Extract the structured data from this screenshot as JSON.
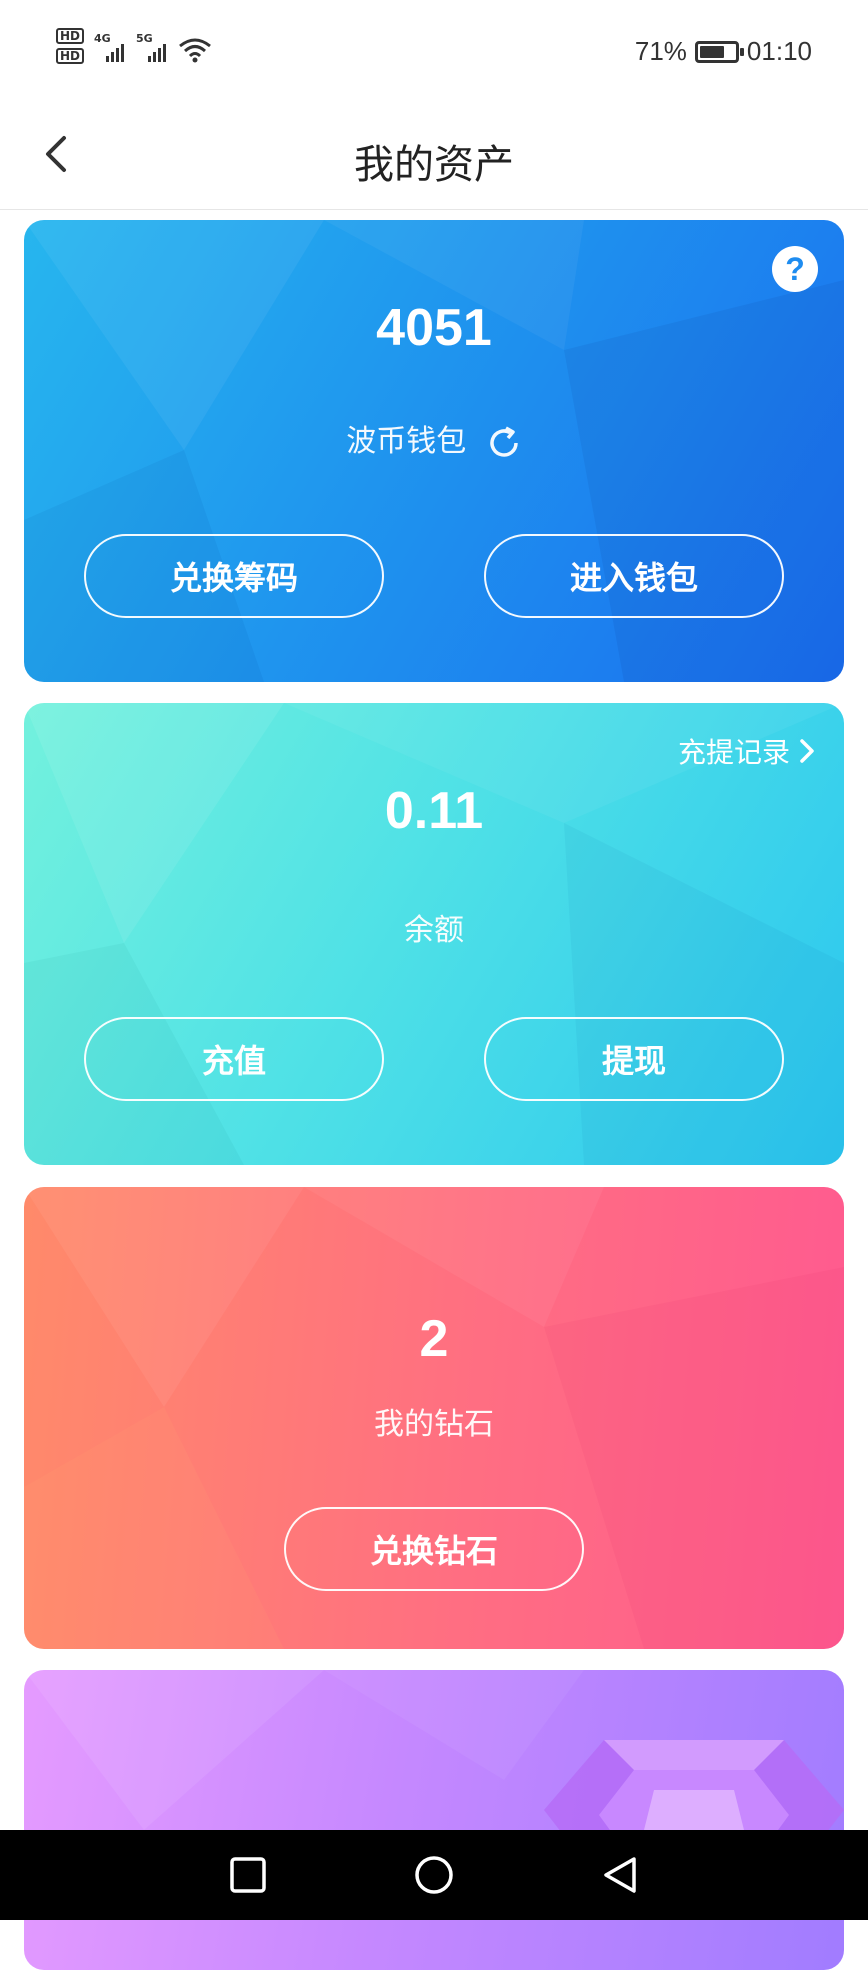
{
  "status_bar": {
    "hd1": "HD",
    "hd2": "HD",
    "net1": "4G",
    "net2": "5G",
    "battery_pct_text": "71%",
    "battery_level": 0.71,
    "time": "01:10",
    "icons": [
      "hd-icon",
      "signal-icon",
      "wifi-icon",
      "battery-charging-icon"
    ]
  },
  "header": {
    "title": "我的资产",
    "back_icon": "chevron-left-icon"
  },
  "cards": {
    "wallet": {
      "value": "4051",
      "label": "波币钱包",
      "help_icon": "?",
      "buttons": [
        "兑换筹码",
        "进入钱包"
      ],
      "colors": [
        "#27b6ee",
        "#1a6ef0"
      ]
    },
    "balance": {
      "value": "0.11",
      "label": "余额",
      "records_link": "充提记录",
      "buttons": [
        "充值",
        "提现"
      ],
      "colors": [
        "#73f1dd",
        "#2bc6ef"
      ]
    },
    "diamond": {
      "value": "2",
      "label": "我的钻石",
      "buttons": [
        "兑换钻石"
      ],
      "colors": [
        "#ff8a6a",
        "#ff5a90"
      ]
    },
    "purple": {
      "colors": [
        "#e59bff",
        "#a17cff"
      ]
    }
  },
  "nav_bar": {
    "icons": [
      "recents-square-icon",
      "home-circle-icon",
      "back-triangle-icon"
    ]
  }
}
